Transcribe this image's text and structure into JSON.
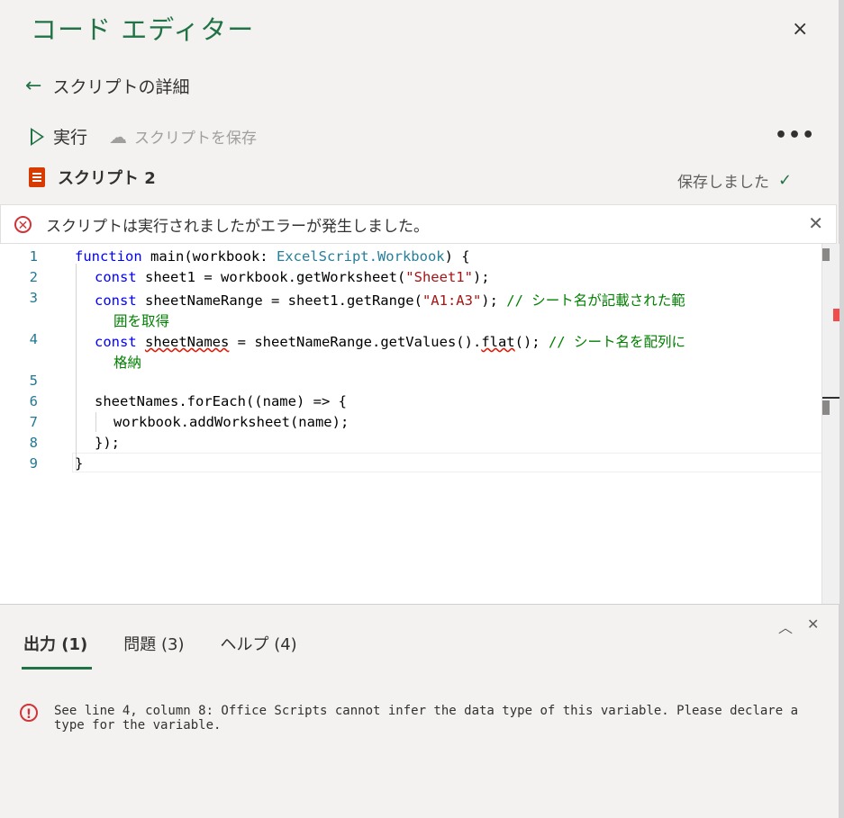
{
  "header": {
    "title": "コード エディター",
    "close_icon": "×",
    "back_label": "スクリプトの詳細"
  },
  "toolbar": {
    "run_label": "実行",
    "save_label": "スクリプトを保存",
    "more_label": "•••"
  },
  "script": {
    "name": "スクリプト 2",
    "status": "保存しました"
  },
  "error_banner": {
    "message": "スクリプトは実行されましたがエラーが発生しました。"
  },
  "editor": {
    "line_numbers": [
      "1",
      "2",
      "3",
      "4",
      "5",
      "6",
      "7",
      "8",
      "9"
    ],
    "code": {
      "l1_kw": "function",
      "l1_a": " main(workbook: ",
      "l1_ty": "ExcelScript.Workbook",
      "l1_b": ") {",
      "l2_kw": "const",
      "l2_a": " sheet1 = workbook.getWorksheet(",
      "l2_st": "\"Sheet1\"",
      "l2_b": ");",
      "l3_kw": "const",
      "l3_a": " sheetNameRange = sheet1.getRange(",
      "l3_st": "\"A1:A3\"",
      "l3_b": "); ",
      "l3_cm": "// シート名が記載された範",
      "l3_cm2": "囲を取得",
      "l4_kw": "const",
      "l4_sq": "sheetNames",
      "l4_a": " = sheetNameRange.getValues().",
      "l4_sq2": "flat",
      "l4_b": "(); ",
      "l4_cm": "// シート名を配列に",
      "l4_cm2": "格納",
      "l6": "sheetNames.forEach((name) => {",
      "l7": "workbook.addWorksheet(name);",
      "l8": "});",
      "l9": "}"
    }
  },
  "panel": {
    "tabs": [
      {
        "label": "出力 (1)"
      },
      {
        "label": "問題 (3)"
      },
      {
        "label": "ヘルプ (4)"
      }
    ],
    "message": "See line 4, column 8: Office Scripts cannot infer the data type of this variable. Please declare a type for the variable."
  },
  "colors": {
    "accent": "#217346",
    "error": "#d13438",
    "keyword": "#0000ff",
    "string": "#a31515",
    "comment": "#008000"
  }
}
